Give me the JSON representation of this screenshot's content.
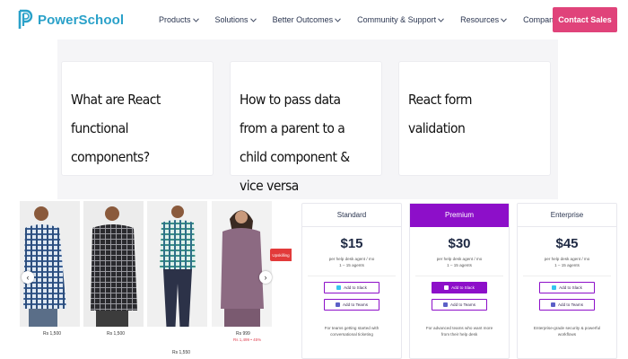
{
  "header": {
    "brand": "PowerSchool",
    "nav": [
      {
        "label": "Products"
      },
      {
        "label": "Solutions"
      },
      {
        "label": "Better Outcomes"
      },
      {
        "label": "Community & Support"
      },
      {
        "label": "Resources"
      },
      {
        "label": "Company"
      }
    ],
    "cta_label": "Contact Sales"
  },
  "articles": [
    {
      "title": "What are React functional components?"
    },
    {
      "title": "How to pass data from a parent to a child component & vice versa"
    },
    {
      "title": "React form validation"
    }
  ],
  "products": {
    "items": [
      {
        "price": "Rs 1,500"
      },
      {
        "price": "Rs 1,500"
      },
      {
        "price": "Rs 1,550"
      },
      {
        "price": "Rs 999",
        "sub": "Rs 1,499  • 45%"
      }
    ],
    "badge": "Upskilling",
    "prev_icon": "chevron-left-icon",
    "next_icon": "chevron-right-icon"
  },
  "pricing": {
    "accent": "#8d0fc9",
    "plans": [
      {
        "name": "Standard",
        "price": "$15",
        "desc_1": "per help desk agent / mo",
        "desc_2": "1 – 15 agents",
        "slack": "Add to Slack",
        "teams": "Add to Teams",
        "foot_1": "For teams getting started with",
        "foot_2": "conversational ticketing"
      },
      {
        "name": "Premium",
        "price": "$30",
        "desc_1": "per help desk agent / mo",
        "desc_2": "1 – 15 agents",
        "slack": "Add to Slack",
        "teams": "Add to Teams",
        "foot_1": "For advanced teams who want more",
        "foot_2": "from their help desk"
      },
      {
        "name": "Enterprise",
        "price": "$45",
        "desc_1": "per help desk agent / mo",
        "desc_2": "1 – 15 agents",
        "slack": "Add to Slack",
        "teams": "Add to Teams",
        "foot_1": "Enterprise-grade security & powerful",
        "foot_2": "workflows"
      }
    ]
  }
}
